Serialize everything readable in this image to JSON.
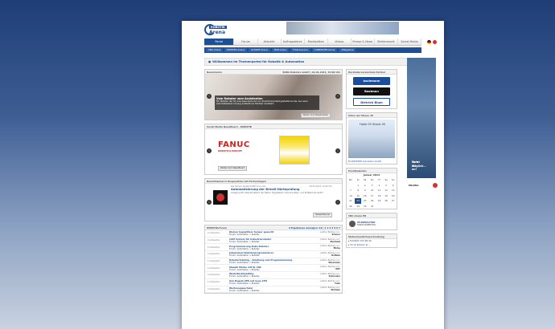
{
  "logo": {
    "line1": "ROBOTIK",
    "line2": "Arena"
  },
  "nav": {
    "items": [
      "Portal",
      "Forum",
      "Aktuelle Meldung",
      "Auftragsbörse",
      "Marktplätze",
      "Videos",
      "Presse & News",
      "Stellenmarkt",
      "Social Media"
    ]
  },
  "subnav": [
    "CNC-Arena",
    "ELEKTRO-Arena",
    "SCHLEIF-Arena",
    "PUM-Arena",
    "TOOLS-Arena",
    "COMPOSITE-Arena",
    "eMagazine"
  ],
  "welcome": "Willkommen im Themenportal für Robotik & Automation",
  "newscenter": {
    "header": "NewsCenter",
    "meta": "BURA Robotex GmbH | 02.01.2013, 15:06 Uhr",
    "caption_title": "Vom Roboter zum Assistenten",
    "caption_text": "Ein Roboter der für eine besondere Art von Zusammenarbeit gestaltet wurde. Aus einer automatisierten Lösung entsteht ein flexibler Assistent.",
    "more_button": "Weiter zum NewsCenter"
  },
  "social": {
    "header": "Social Media NewsBoard - ROBOTIK",
    "fanuc": "FANUC",
    "fanuc_sub": "ROBOTICS EUROPE",
    "more_button": "Weiter zum NewsBoard"
  },
  "newschannel": {
    "header": "NewsChannel in Kooperation mit Fachverlagen",
    "source": "Die Hanser Verlag GmbH & Co. KG",
    "date": "09.01.2013, 10:00 Uhr",
    "title": "Automatisierung der Brinell-Härteprüfung",
    "teaser": "Anlage prüft vollautomatisch die Härte / fergestellt in Porsche Werk- und Prüftechnik GmbH",
    "more_button": "NewsChannel"
  },
  "forum": {
    "header": "ROBOTIK-Forum",
    "meta": "9 Ergebnisse anzeigen: 10 | 1 2 3 4 5 6 7",
    "rows": [
      {
        "answers": "2 Antworten",
        "title": "Kleiner kapazitiver Sensor gesucht",
        "forum": "Forum: Automation > Roboter",
        "last": "Letzter Beitrag von:",
        "user": "Kramer"
      },
      {
        "answers": "0 Antworten",
        "title": "CAM System für Industrieroboter",
        "forum": "Forum: Automation > Roboter",
        "last": "Letzter Beitrag von:",
        "user": "Rienhold"
      },
      {
        "answers": "6 Antworten",
        "title": "Programmierung Kuka Roboter",
        "forum": "Forum: Automation > Roboter",
        "last": "Letzter Beitrag von:",
        "user": "Elkins"
      },
      {
        "answers": "0 Antworten",
        "title": "Jobwechsel Roboterprogrammierer",
        "forum": "Forum: Automation > Roboter",
        "last": "Letzter Beitrag von:",
        "user": "Rolfebe"
      },
      {
        "answers": "1 Antworten",
        "title": "Robotertraining - Anleitung und Programmierung",
        "forum": "Forum: Automation > Roboter",
        "last": "Letzter Beitrag von:",
        "user": "Wieseman"
      },
      {
        "answers": "2 Antworten",
        "title": "Staubli Marke mit SL 200",
        "forum": "Forum: Automation > Roboter",
        "last": "Letzter Beitrag von:",
        "user": "NST"
      },
      {
        "answers": "3 Antworten",
        "title": "Werkstückhandling",
        "forum": "Forum: Automation > Roboter",
        "last": "Letzter Beitrag von:",
        "user": "Petersohn"
      },
      {
        "answers": "1 Antworten",
        "title": "Von Kugeln SPS auf neue CPU",
        "forum": "Forum: Automation > Roboter",
        "last": "Letzter Beitrag von:",
        "user": "Felix"
      },
      {
        "answers": "2 Antworten",
        "title": "Werkzeugwechsler",
        "forum": "Forum: Automation > Roboter",
        "last": "Letzter Beitrag von:",
        "user": "Steinlan"
      }
    ]
  },
  "partners": {
    "header": "Herstellerverzeichnis Partner",
    "items": [
      {
        "name": "bachmann",
        "color": "#1a4d9c"
      },
      {
        "name": "Bostman",
        "color": "#111111"
      },
      {
        "name": "Dietrich Blum",
        "color": "#ffffff"
      }
    ]
  },
  "video": {
    "header": "Video der Messe 30",
    "label": "Halle 05 Stand 05",
    "caption": "EC BLECHERT Automation GmbH"
  },
  "calendar": {
    "header": "Eventkalender",
    "month": "Januar 2013",
    "days": [
      "Mo",
      "Di",
      "Mi",
      "Do",
      "Fr",
      "Sa",
      "So"
    ],
    "weeks": [
      [
        "",
        "1",
        "2",
        "3",
        "4",
        "5",
        "6"
      ],
      [
        "7",
        "8",
        "9",
        "10",
        "11",
        "12",
        "13"
      ],
      [
        "14",
        "15",
        "16",
        "17",
        "18",
        "19",
        "20"
      ],
      [
        "21",
        "22",
        "23",
        "24",
        "25",
        "26",
        "27"
      ],
      [
        "28",
        "29",
        "30",
        "31",
        "",
        "",
        ""
      ]
    ],
    "highlight": "22"
  },
  "cnc": {
    "header": "CNC-Arena ED",
    "title": "05-R050A/250P",
    "sub": "FANUC ROBOTICS"
  },
  "jobs": {
    "header": "Stellenmarkt/Ausschreibung",
    "items": [
      "▸ ELSCRAT 5x9 000 Kk",
      "▸ 57c(t) Roboter Kr..."
    ]
  },
  "sidead": {
    "text1": "Ex ist möglich...",
    "text2": "Turn Me on!"
  },
  "erowa": "EROWA",
  "colors": {
    "brand": "#1d4f96",
    "accent": "#d21f1f"
  }
}
